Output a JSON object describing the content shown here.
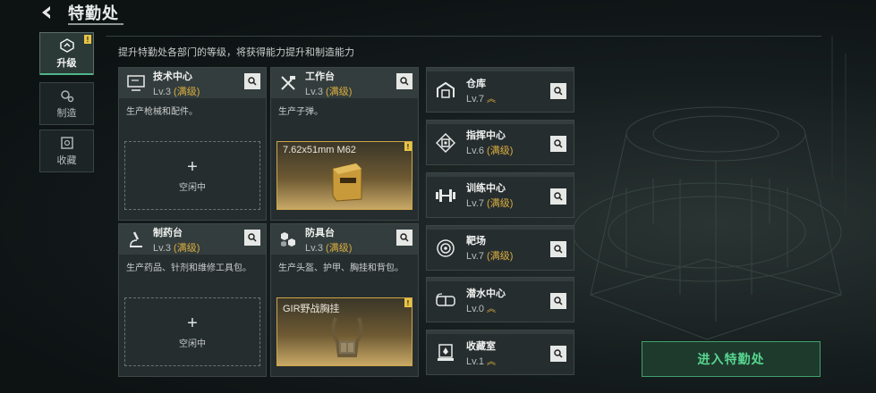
{
  "header": {
    "title": "特勤处"
  },
  "nav": {
    "items": [
      {
        "label": "升级",
        "active": true,
        "badge": "!"
      },
      {
        "label": "制造",
        "active": false
      },
      {
        "label": "收藏",
        "active": false
      }
    ]
  },
  "subtitle": "提升特勤处各部门的等级，将获得能力提升和制造能力",
  "cards": [
    {
      "name": "技术中心",
      "level": "Lv.3",
      "status": "(满级)",
      "desc": "生产枪械和配件。",
      "slot_type": "idle",
      "slot_label": "空闲中",
      "slot_plus": "+"
    },
    {
      "name": "工作台",
      "level": "Lv.3",
      "status": "(满级)",
      "desc": "生产子弹。",
      "slot_type": "product",
      "product_name": "7.62x51mm M62",
      "badge": "!"
    },
    {
      "name": "制药台",
      "level": "Lv.3",
      "status": "(满级)",
      "desc": "生产药品、针剂和维修工具包。",
      "slot_type": "idle",
      "slot_label": "空闲中",
      "slot_plus": "+"
    },
    {
      "name": "防具台",
      "level": "Lv.3",
      "status": "(满级)",
      "desc": "生产头盔、护甲、胸挂和背包。",
      "slot_type": "product",
      "product_name": "GIR野战胸挂",
      "badge": "!"
    }
  ],
  "small_cards": [
    {
      "name": "仓库",
      "level": "Lv.7",
      "status": "",
      "arrow": "︽"
    },
    {
      "name": "指挥中心",
      "level": "Lv.6",
      "status": "(满级)",
      "arrow": ""
    },
    {
      "name": "训练中心",
      "level": "Lv.7",
      "status": "(满级)",
      "arrow": ""
    },
    {
      "name": "靶场",
      "level": "Lv.7",
      "status": "(满级)",
      "arrow": ""
    },
    {
      "name": "潜水中心",
      "level": "Lv.0",
      "status": "",
      "arrow": "︽"
    },
    {
      "name": "收藏室",
      "level": "Lv.1",
      "status": "",
      "arrow": "︽"
    }
  ],
  "enter_button": "进入特勤处",
  "colors": {
    "accent_green": "#58d68f",
    "gold": "#d9ae3f",
    "badge_yellow": "#e8c446"
  }
}
